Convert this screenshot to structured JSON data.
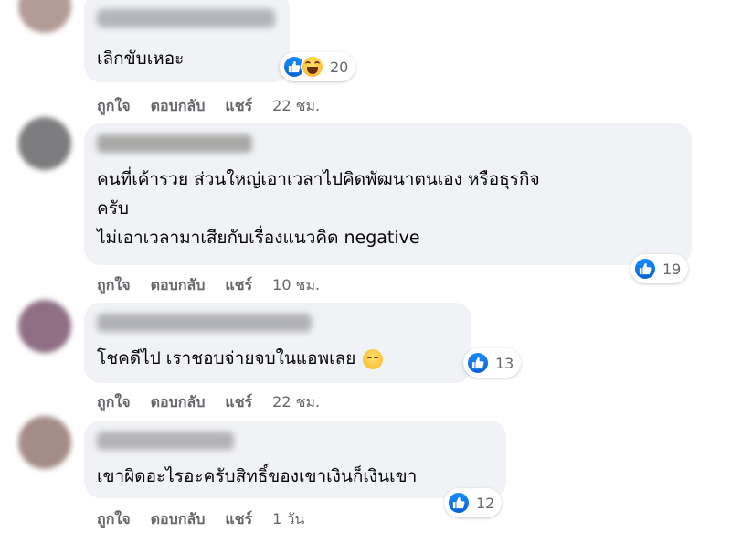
{
  "comments": [
    {
      "text_lines": [
        "เลิกขับเหอะ"
      ],
      "reaction_count": "20",
      "reactions": [
        "like-icon",
        "haha-icon"
      ],
      "actions": {
        "like": "ถูกใจ",
        "reply": "ตอบกลับ",
        "share": "แชร์",
        "time": "22 ชม."
      }
    },
    {
      "text_lines": [
        "คนที่เค้ารวย ส่วนใหญ่เอาเวลาไปคิดพัฒนาตนเอง หรือธุรกิจ",
        "ครับ",
        "ไม่เอาเวลามาเสียกับเรื่องแนวคิด negative"
      ],
      "reaction_count": "19",
      "reactions": [
        "like-icon"
      ],
      "actions": {
        "like": "ถูกใจ",
        "reply": "ตอบกลับ",
        "share": "แชร์",
        "time": "10 ชม."
      }
    },
    {
      "text_lines": [
        "โชคดีไป เราชอบจ่ายจบในแอพเลย"
      ],
      "reaction_count": "13",
      "reactions": [
        "like-icon"
      ],
      "actions": {
        "like": "ถูกใจ",
        "reply": "ตอบกลับ",
        "share": "แชร์",
        "time": "22 ชม."
      }
    },
    {
      "text_lines": [
        "เขาผิดอะไรอะครับสิทธิ์ของเขาเงินก็เงินเขา"
      ],
      "reaction_count": "12",
      "reactions": [
        "like-icon"
      ],
      "actions": {
        "like": "ถูกใจ",
        "reply": "ตอบกลับ",
        "share": "แชร์",
        "time": "1 วัน"
      }
    }
  ],
  "colors": {
    "bubble": "#f0f2f5",
    "meta_text": "#65676b",
    "like_blue": "#1877f2"
  }
}
